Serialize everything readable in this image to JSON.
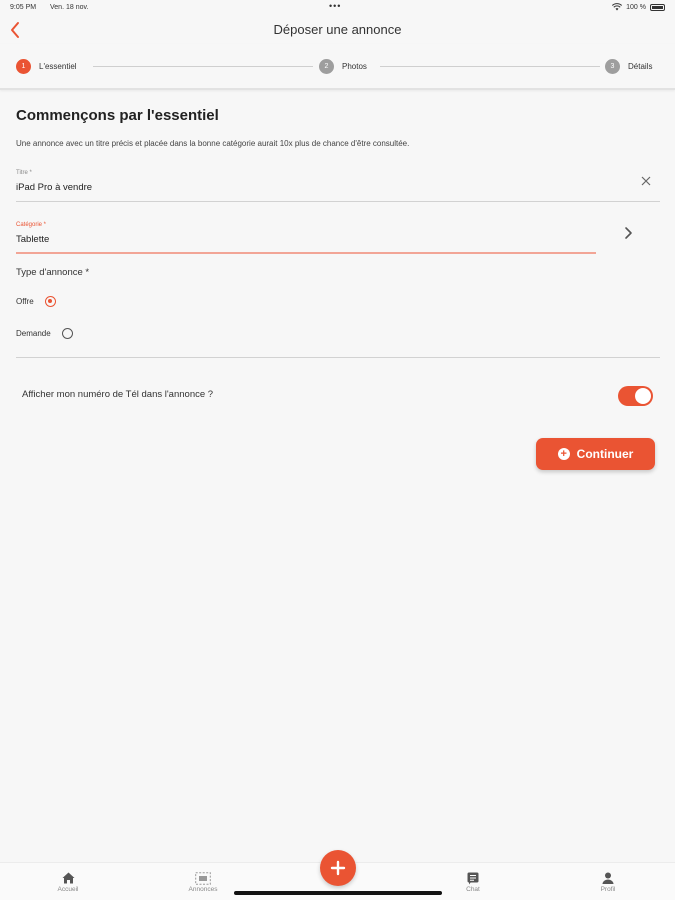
{
  "status_bar": {
    "time": "9:05 PM",
    "date": "Ven. 18 nov.",
    "battery": "100 %"
  },
  "nav": {
    "title": "Déposer une annonce"
  },
  "stepper": {
    "steps": [
      {
        "num": "1",
        "label": "L'essentiel"
      },
      {
        "num": "2",
        "label": "Photos"
      },
      {
        "num": "3",
        "label": "Détails"
      }
    ]
  },
  "form": {
    "section_title": "Commençons par l'essentiel",
    "intro": "Une annonce avec un titre précis et placée dans la bonne catégorie aurait 10x plus de chance d'être consultée.",
    "title_field": {
      "label": "Titre *",
      "value": "iPad Pro à vendre"
    },
    "category_field": {
      "label": "Catégorie *",
      "value": "Tablette"
    },
    "type_label": "Type d'annonce *",
    "type_options": [
      {
        "label": "Offre",
        "checked": true
      },
      {
        "label": "Demande",
        "checked": false
      }
    ],
    "phone_label": "Afficher mon numéro de Tél dans l'annonce ?",
    "phone_toggle": true,
    "continue_label": "Continuer"
  },
  "colors": {
    "accent": "#ea5433"
  },
  "tab_bar": {
    "tabs": [
      {
        "label": "Accueil",
        "icon": "home-icon"
      },
      {
        "label": "Annonces",
        "icon": "listings-icon"
      },
      {
        "label": "Chat",
        "icon": "chat-icon"
      },
      {
        "label": "Profil",
        "icon": "profile-icon"
      }
    ]
  }
}
